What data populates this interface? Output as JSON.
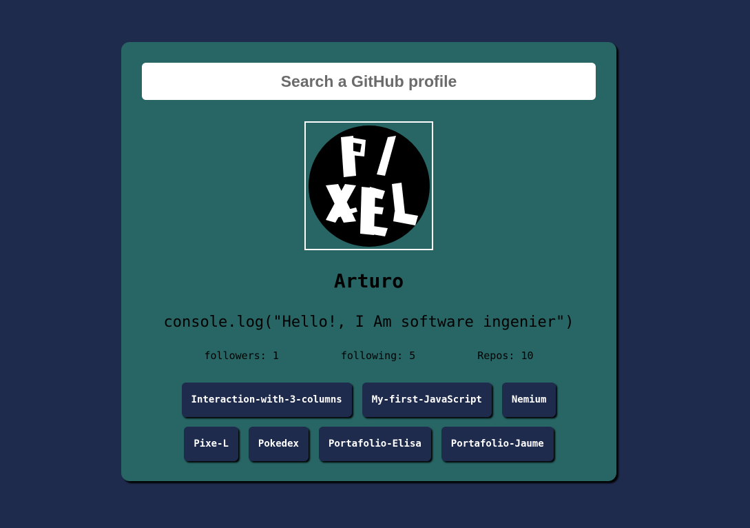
{
  "search": {
    "placeholder": "Search a GitHub profile",
    "value": ""
  },
  "profile": {
    "avatar_icon": "pixel-logo-avatar",
    "name": "Arturo",
    "bio": "console.log(\"Hello!, I Am software ingenier\")"
  },
  "stats": {
    "followers": "followers: 1",
    "following": "following: 5",
    "repos": "Repos: 10"
  },
  "repositories": [
    "Interaction-with-3-columns",
    "My-first-JavaScript",
    "Nemium",
    "Pixe-L",
    "Pokedex",
    "Portafolio-Elisa",
    "Portafolio-Jaume"
  ],
  "colors": {
    "background": "#1f2b4d",
    "card": "#286565",
    "repo_button": "#1f2b4d"
  }
}
